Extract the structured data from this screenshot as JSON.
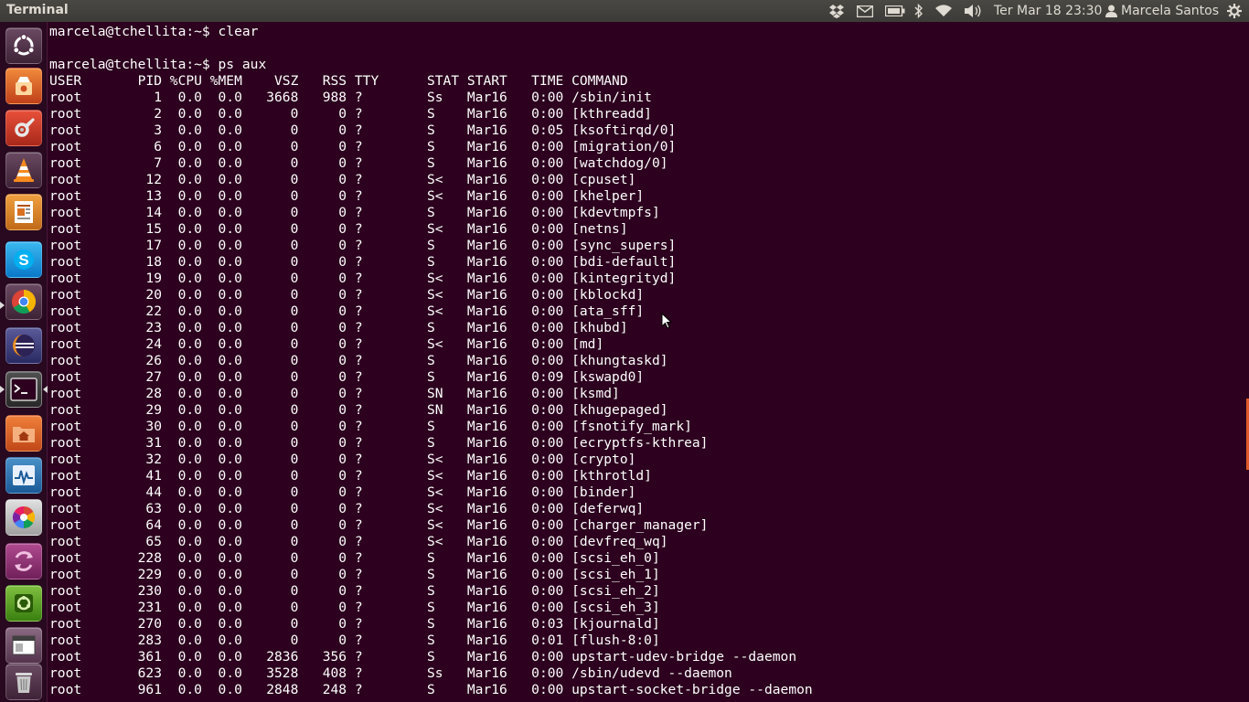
{
  "panel": {
    "app_title": "Terminal",
    "clock": "Ter Mar 18 23:30",
    "user_name": "Marcela Santos",
    "tray_icons": [
      "dropbox-icon",
      "mail-icon",
      "battery-icon",
      "bluetooth-icon",
      "wifi-icon",
      "volume-icon",
      "user-icon",
      "gear-icon"
    ]
  },
  "launcher": {
    "items": [
      {
        "name": "dash-home",
        "icon": "ubuntu-logo-icon",
        "running": false
      },
      {
        "name": "app-launcher-1",
        "icon": "app-orange-icon",
        "running": false
      },
      {
        "name": "system-settings",
        "icon": "settings-tools-icon",
        "running": false
      },
      {
        "name": "vlc",
        "icon": "vlc-cone-icon",
        "running": false
      },
      {
        "name": "libreoffice-impress",
        "icon": "presentation-icon",
        "running": false
      },
      {
        "name": "skype",
        "icon": "skype-icon",
        "running": false
      },
      {
        "name": "chrome",
        "icon": "chrome-icon",
        "running": true
      },
      {
        "name": "eclipse",
        "icon": "eclipse-icon",
        "running": false
      },
      {
        "name": "terminal",
        "icon": "terminal-icon",
        "running": true,
        "focused": true
      },
      {
        "name": "home-folder",
        "icon": "home-folder-icon",
        "running": false
      },
      {
        "name": "system-monitor",
        "icon": "system-monitor-icon",
        "running": false
      },
      {
        "name": "picasa",
        "icon": "picasa-icon",
        "running": false
      },
      {
        "name": "workspace-switcher",
        "icon": "workspace-switcher-icon",
        "running": false
      },
      {
        "name": "software-updater",
        "icon": "software-updater-icon",
        "running": false
      },
      {
        "name": "window-app",
        "icon": "window-icon",
        "running": false
      },
      {
        "name": "trash",
        "icon": "trash-icon",
        "running": false
      }
    ]
  },
  "terminal": {
    "lines": [
      "marcela@tchellita:~$ clear",
      "",
      "marcela@tchellita:~$ ps aux",
      "USER       PID %CPU %MEM    VSZ   RSS TTY      STAT START   TIME COMMAND",
      "root         1  0.0  0.0   3668   988 ?        Ss   Mar16   0:00 /sbin/init",
      "root         2  0.0  0.0      0     0 ?        S    Mar16   0:00 [kthreadd]",
      "root         3  0.0  0.0      0     0 ?        S    Mar16   0:05 [ksoftirqd/0]",
      "root         6  0.0  0.0      0     0 ?        S    Mar16   0:00 [migration/0]",
      "root         7  0.0  0.0      0     0 ?        S    Mar16   0:00 [watchdog/0]",
      "root        12  0.0  0.0      0     0 ?        S<   Mar16   0:00 [cpuset]",
      "root        13  0.0  0.0      0     0 ?        S<   Mar16   0:00 [khelper]",
      "root        14  0.0  0.0      0     0 ?        S    Mar16   0:00 [kdevtmpfs]",
      "root        15  0.0  0.0      0     0 ?        S<   Mar16   0:00 [netns]",
      "root        17  0.0  0.0      0     0 ?        S    Mar16   0:00 [sync_supers]",
      "root        18  0.0  0.0      0     0 ?        S    Mar16   0:00 [bdi-default]",
      "root        19  0.0  0.0      0     0 ?        S<   Mar16   0:00 [kintegrityd]",
      "root        20  0.0  0.0      0     0 ?        S<   Mar16   0:00 [kblockd]",
      "root        22  0.0  0.0      0     0 ?        S<   Mar16   0:00 [ata_sff]",
      "root        23  0.0  0.0      0     0 ?        S    Mar16   0:00 [khubd]",
      "root        24  0.0  0.0      0     0 ?        S<   Mar16   0:00 [md]",
      "root        26  0.0  0.0      0     0 ?        S    Mar16   0:00 [khungtaskd]",
      "root        27  0.0  0.0      0     0 ?        S    Mar16   0:09 [kswapd0]",
      "root        28  0.0  0.0      0     0 ?        SN   Mar16   0:00 [ksmd]",
      "root        29  0.0  0.0      0     0 ?        SN   Mar16   0:00 [khugepaged]",
      "root        30  0.0  0.0      0     0 ?        S    Mar16   0:00 [fsnotify_mark]",
      "root        31  0.0  0.0      0     0 ?        S    Mar16   0:00 [ecryptfs-kthrea]",
      "root        32  0.0  0.0      0     0 ?        S<   Mar16   0:00 [crypto]",
      "root        41  0.0  0.0      0     0 ?        S<   Mar16   0:00 [kthrotld]",
      "root        44  0.0  0.0      0     0 ?        S<   Mar16   0:00 [binder]",
      "root        63  0.0  0.0      0     0 ?        S<   Mar16   0:00 [deferwq]",
      "root        64  0.0  0.0      0     0 ?        S<   Mar16   0:00 [charger_manager]",
      "root        65  0.0  0.0      0     0 ?        S<   Mar16   0:00 [devfreq_wq]",
      "root       228  0.0  0.0      0     0 ?        S    Mar16   0:00 [scsi_eh_0]",
      "root       229  0.0  0.0      0     0 ?        S    Mar16   0:00 [scsi_eh_1]",
      "root       230  0.0  0.0      0     0 ?        S    Mar16   0:00 [scsi_eh_2]",
      "root       231  0.0  0.0      0     0 ?        S    Mar16   0:00 [scsi_eh_3]",
      "root       270  0.0  0.0      0     0 ?        S    Mar16   0:03 [kjournald]",
      "root       283  0.0  0.0      0     0 ?        S    Mar16   0:01 [flush-8:0]",
      "root       361  0.0  0.0   2836   356 ?        S    Mar16   0:00 upstart-udev-bridge --daemon",
      "root       623  0.0  0.0   3528   408 ?        Ss   Mar16   0:00 /sbin/udevd --daemon",
      "root       961  0.0  0.0   2848   248 ?        S    Mar16   0:00 upstart-socket-bridge --daemon"
    ]
  },
  "colors": {
    "terminal_bg": "#2c001e",
    "terminal_fg": "#ffffff",
    "panel_bg": "#3c3b37",
    "panel_fg": "#dfdbd2",
    "accent": "#e05a2a"
  }
}
